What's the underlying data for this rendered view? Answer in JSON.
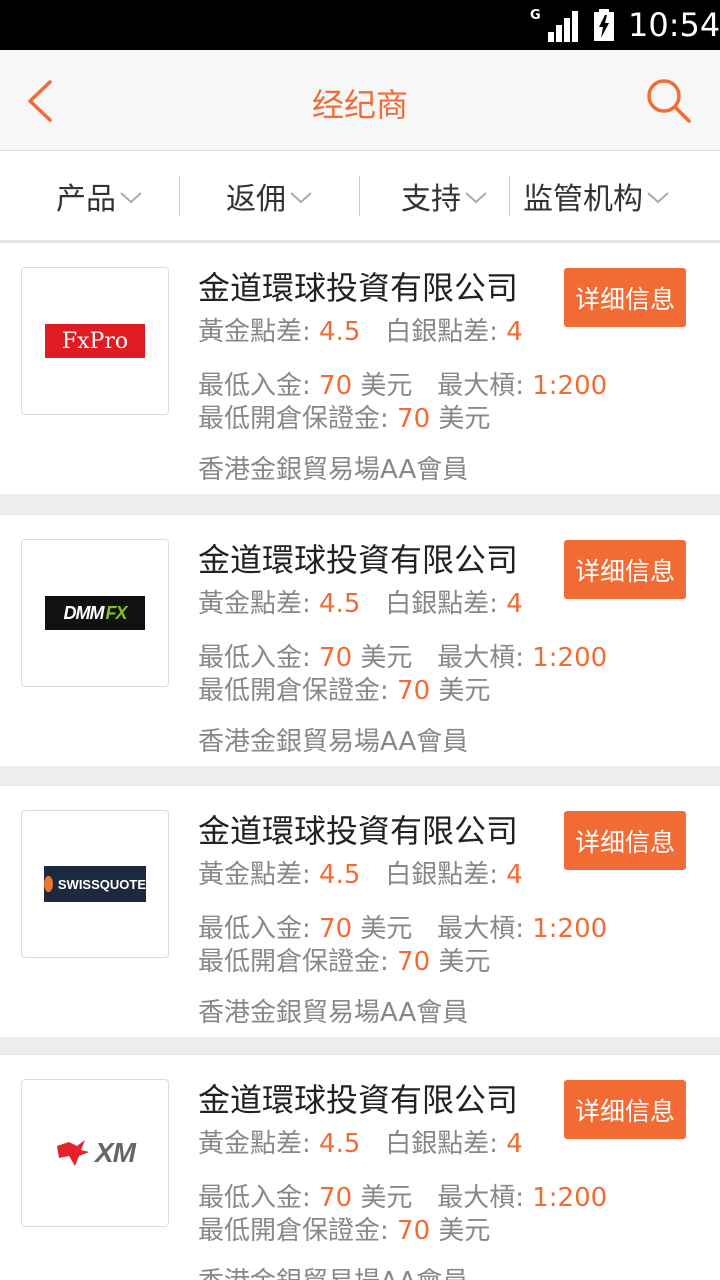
{
  "status_bar": {
    "network": "G",
    "time": "10:54"
  },
  "header": {
    "title": "经纪商"
  },
  "filters": [
    {
      "label": "产品"
    },
    {
      "label": "返佣"
    },
    {
      "label": "支持"
    },
    {
      "label": "监管机构"
    }
  ],
  "brokers": [
    {
      "logo": "FxPro",
      "company": "金道環球投資有限公司",
      "gold_spread_label": "黃金點差:",
      "gold_spread": "4.5",
      "silver_spread_label": "白銀點差:",
      "silver_spread": "4",
      "min_deposit_label": "最低入金:",
      "min_deposit": "70",
      "currency": "美元",
      "max_leverage_label": "最大槓:",
      "max_leverage": "1:200",
      "min_margin_label": "最低開倉保證金:",
      "min_margin": "70",
      "membership": "香港金銀貿易場AA會員",
      "detail_label": "详细信息"
    },
    {
      "logo_main": "DMM",
      "logo_accent": "FX",
      "company": "金道環球投資有限公司",
      "gold_spread_label": "黃金點差:",
      "gold_spread": "4.5",
      "silver_spread_label": "白銀點差:",
      "silver_spread": "4",
      "min_deposit_label": "最低入金:",
      "min_deposit": "70",
      "currency": "美元",
      "max_leverage_label": "最大槓:",
      "max_leverage": "1:200",
      "min_margin_label": "最低開倉保證金:",
      "min_margin": "70",
      "membership": "香港金銀貿易場AA會員",
      "detail_label": "详细信息"
    },
    {
      "logo": "SWISSQUOTE",
      "company": "金道環球投資有限公司",
      "gold_spread_label": "黃金點差:",
      "gold_spread": "4.5",
      "silver_spread_label": "白銀點差:",
      "silver_spread": "4",
      "min_deposit_label": "最低入金:",
      "min_deposit": "70",
      "currency": "美元",
      "max_leverage_label": "最大槓:",
      "max_leverage": "1:200",
      "min_margin_label": "最低開倉保證金:",
      "min_margin": "70",
      "membership": "香港金銀貿易場AA會員",
      "detail_label": "详细信息"
    },
    {
      "logo": "XM",
      "company": "金道環球投資有限公司",
      "gold_spread_label": "黃金點差:",
      "gold_spread": "4.5",
      "silver_spread_label": "白銀點差:",
      "silver_spread": "4",
      "min_deposit_label": "最低入金:",
      "min_deposit": "70",
      "currency": "美元",
      "max_leverage_label": "最大槓:",
      "max_leverage": "1:200",
      "min_margin_label": "最低開倉保證金:",
      "min_margin": "70",
      "membership": "香港金銀貿易場AA會員",
      "detail_label": "详细信息"
    }
  ],
  "colors": {
    "accent": "#f26b35",
    "text_primary": "#222222",
    "text_secondary": "#888888",
    "separator": "#eeeeee"
  }
}
